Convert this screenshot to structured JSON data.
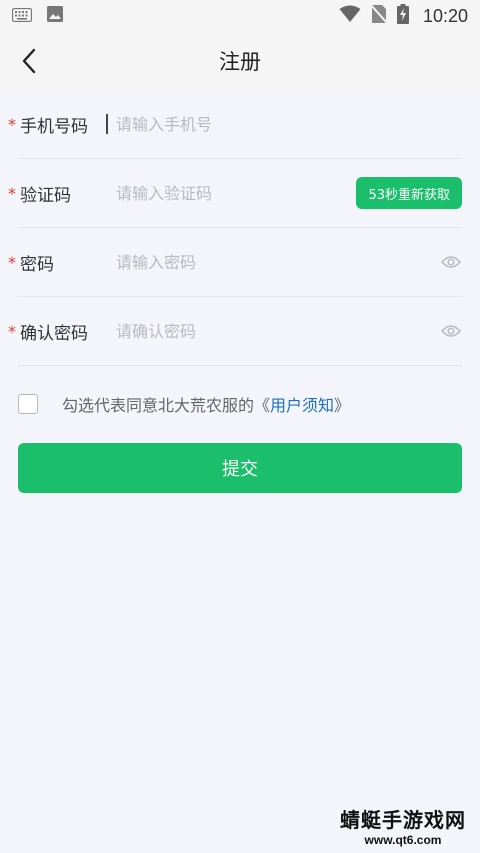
{
  "status_bar": {
    "time": "10:20",
    "icons": [
      "keyboard-icon",
      "image-icon",
      "wifi-icon",
      "no-sim-icon",
      "battery-charging-icon"
    ]
  },
  "nav": {
    "title": "注册",
    "back_icon": "chevron-left-icon"
  },
  "form": {
    "required_mark": "*",
    "phone": {
      "label": "手机号码",
      "placeholder": "请输入手机号",
      "value": ""
    },
    "code": {
      "label": "验证码",
      "placeholder": "请输入验证码",
      "value": "",
      "button": "53秒重新获取"
    },
    "password": {
      "label": "密码",
      "placeholder": "请输入密码",
      "value": ""
    },
    "confirm": {
      "label": "确认密码",
      "placeholder": "请确认密码",
      "value": ""
    }
  },
  "agreement": {
    "checked": false,
    "prefix": "勾选代表同意北大荒农服的《",
    "link": "用户须知",
    "suffix": "》"
  },
  "submit": {
    "label": "提交"
  },
  "colors": {
    "accent": "#1bbf6b",
    "required": "#e03a2e",
    "link": "#1e6fc0",
    "background": "#f3f5fa"
  },
  "watermark": {
    "text": "蜻蜓手游戏网",
    "url": "www.qt6.com"
  }
}
